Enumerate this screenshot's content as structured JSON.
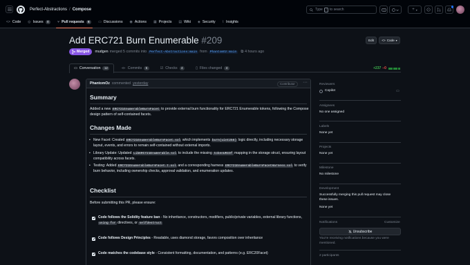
{
  "header": {
    "org": "Perfect-Abstractions",
    "repo": "Compose",
    "search_prefix": "Type",
    "search_key": "/",
    "search_suffix": "to search",
    "plus_label": "+"
  },
  "repo_nav": [
    {
      "label": "Code",
      "icon": "code-icon"
    },
    {
      "label": "Issues",
      "count": "8",
      "icon": "issue-icon"
    },
    {
      "label": "Pull requests",
      "count": "6",
      "icon": "pull-request-icon"
    },
    {
      "label": "Discussions",
      "icon": "discussions-icon"
    },
    {
      "label": "Actions",
      "icon": "play-icon"
    },
    {
      "label": "Projects",
      "icon": "table-icon"
    },
    {
      "label": "Wiki",
      "icon": "book-icon"
    },
    {
      "label": "Security",
      "icon": "shield-icon"
    },
    {
      "label": "Insights",
      "icon": "graph-icon"
    }
  ],
  "pr": {
    "title": "Add ERC721 Burn Enumerable",
    "number": "#209",
    "state": "Merged",
    "merger": "mudgen",
    "merged_text": "merged 5 commits into",
    "base_branch": "Perfect-Abstractions:main",
    "from_text": "from",
    "head_branch": "PhantomOz:main",
    "time": "4 hours ago",
    "edit_label": "Edit",
    "code_label": "Code"
  },
  "pr_tabs": [
    {
      "label": "Conversation",
      "count": "12"
    },
    {
      "label": "Commits",
      "count": "5"
    },
    {
      "label": "Checks",
      "count": "4"
    },
    {
      "label": "Files changed",
      "count": "4"
    }
  ],
  "diffstat": {
    "additions": "+237",
    "deletions": "−0"
  },
  "comment": {
    "author": "PhantomOz",
    "action": "commented",
    "time": "yesterday",
    "badge": "Contributor",
    "summary_heading": "Summary",
    "summary_1": "Added a new ",
    "summary_code": "ERC721EnumerableBurnFacet",
    "summary_2": " to provide external burn functionality for ERC721 Enumerable tokens, following the Compose design pattern of self-contained facets.",
    "changes_heading": "Changes Made",
    "change1_a": "New Facet: Created ",
    "change1_code1": "ERC721EnumerableBurnFacet.sol",
    "change1_b": " which implements ",
    "change1_code2": "burn(uint256)",
    "change1_c": " logic directly, including necessary storage layout, events, and errors to remain self-contained without external imports.",
    "change2_a": "Library Update: Updated ",
    "change2_code1": "LibERC721Enumerable.sol",
    "change2_b": " to include the missing ",
    "change2_code2": "tokenURIOf",
    "change2_c": " mapping in the storage struct, ensuring layout compatibility across facets.",
    "change3_a": "Testing: Added ",
    "change3_code1": "ERC721EnumerableBurnFacet.t.sol",
    "change3_b": " and a corresponding harness ",
    "change3_code2": "ERC721EnumerableBurnFacetHarness.sol",
    "change3_c": " to verify burn behavior, including ownership checks, approval validation, and enumeration updates.",
    "checklist_heading": "Checklist",
    "checklist_intro": "Before submitting this PR, please ensure:",
    "check1_bold": "Code follows the Solidity feature ban",
    "check1_a": " - No inheritance, constructors, modifiers, public/private variables, external library functions, ",
    "check1_code1": "using for",
    "check1_b": " directives, or ",
    "check1_code2": "selfdestruct",
    "check2_bold": "Code follows Design Principles",
    "check2_a": " - Readable, uses diamond storage, favors composition over inheritance",
    "check3_bold": "Code matches the codebase style",
    "check3_a": " - Consistent formatting, documentation, and patterns (e.g. ERC20Facet)"
  },
  "sidebar": {
    "reviewers_label": "Reviewers",
    "reviewer": "Copilot",
    "assignees_label": "Assignees",
    "assignees_value": "No one assigned",
    "labels_label": "Labels",
    "labels_value": "None yet",
    "projects_label": "Projects",
    "projects_value": "None yet",
    "milestone_label": "Milestone",
    "milestone_value": "No milestone",
    "development_label": "Development",
    "development_text": "Successfully merging this pull request may close these issues.",
    "development_value": "None yet",
    "notifications_label": "Notifications",
    "customize_label": "Customize",
    "unsubscribe_label": "Unsubscribe",
    "notifications_text": "You're receiving notifications because you were mentioned.",
    "participants_label": "2 participants"
  },
  "colors": {
    "merged": "#8957e5",
    "accent": "#f78166",
    "link": "#58a6ff",
    "bg": "#0d1117"
  }
}
